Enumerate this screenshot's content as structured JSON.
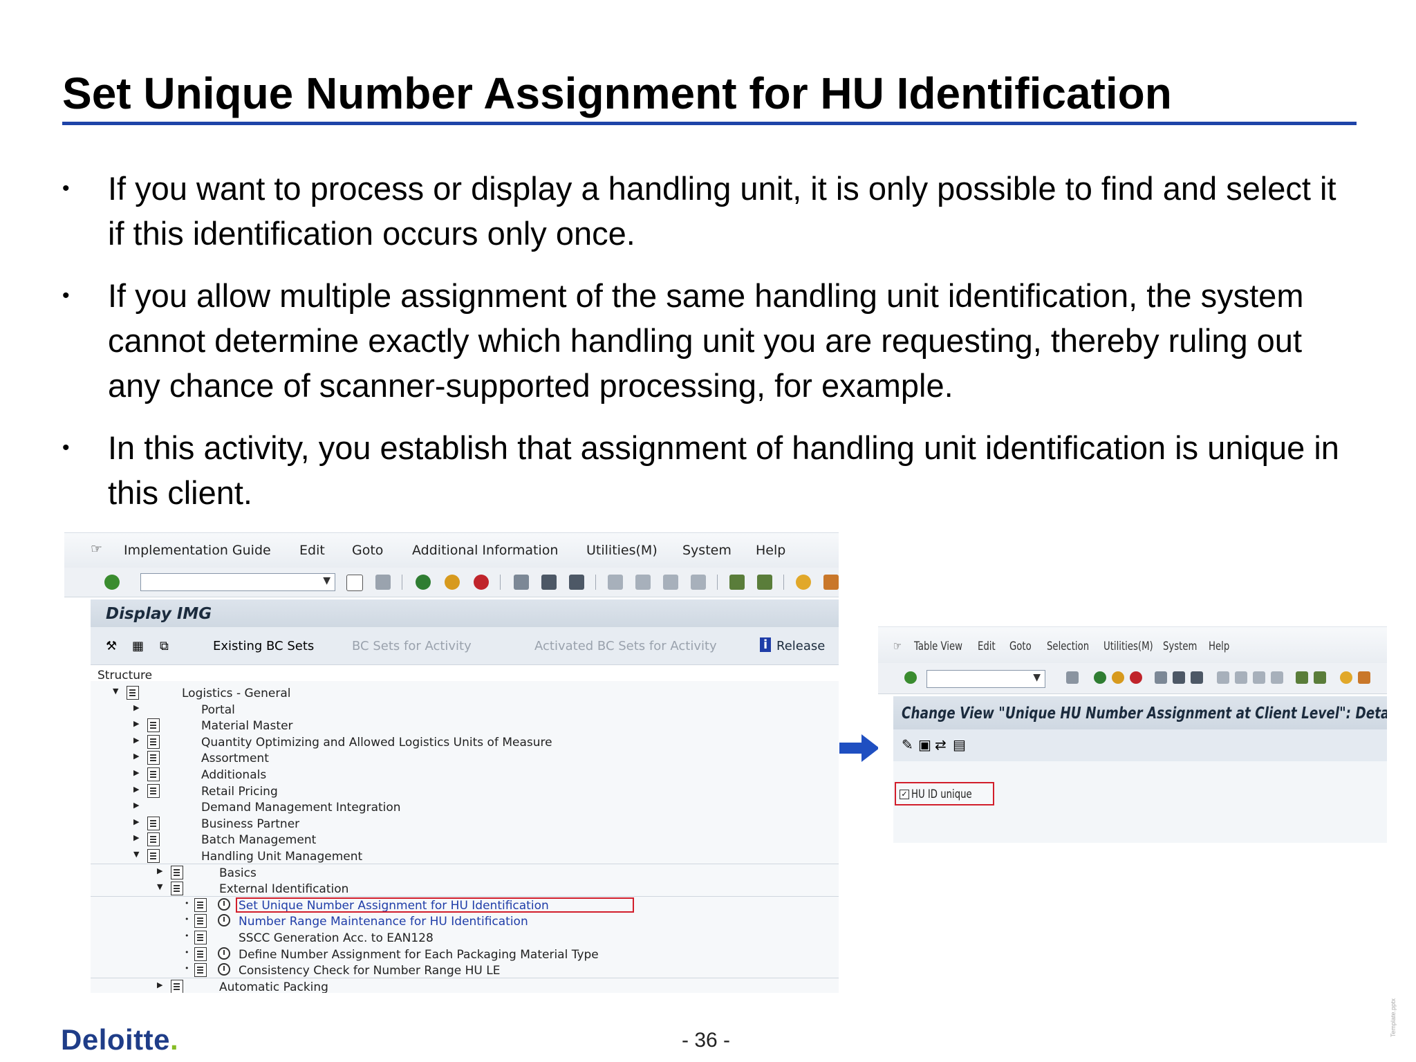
{
  "slide": {
    "title": "Set Unique Number Assignment for HU Identification",
    "bullets": [
      "If you want to process or display a handling unit, it is only possible to find and select it if this identification occurs only once.",
      "If you allow multiple assignment of the same handling unit identification, the system cannot determine exactly which handling unit you are requesting, thereby ruling out any chance of scanner-supported processing, for example.",
      "In this activity, you establish that assignment of handling unit identification is unique in this client."
    ],
    "bullet_marker": "•"
  },
  "sap_img": {
    "menu": [
      "Implementation Guide",
      "Edit",
      "Goto",
      "Additional Information",
      "Utilities(M)",
      "System",
      "Help"
    ],
    "screen_title": "Display IMG",
    "app_toolbar": {
      "existing_bc_sets": "Existing BC Sets",
      "bc_sets_for_activity": "BC Sets for Activity",
      "activated_bc_sets": "Activated BC Sets for Activity",
      "release_notes": "Release"
    },
    "structure_label": "Structure",
    "tree": [
      {
        "label": "Logistics - General",
        "level": 0,
        "expanded": true,
        "icons": "doc"
      },
      {
        "label": "Portal",
        "level": 1,
        "icons": "none"
      },
      {
        "label": "Material Master",
        "level": 1,
        "icons": "doc"
      },
      {
        "label": "Quantity Optimizing and Allowed Logistics Units of Measure",
        "level": 1,
        "icons": "doc"
      },
      {
        "label": "Assortment",
        "level": 1,
        "icons": "doc"
      },
      {
        "label": "Additionals",
        "level": 1,
        "icons": "doc"
      },
      {
        "label": "Retail Pricing",
        "level": 1,
        "icons": "doc"
      },
      {
        "label": "Demand Management Integration",
        "level": 1,
        "icons": "none"
      },
      {
        "label": "Business Partner",
        "level": 1,
        "icons": "doc"
      },
      {
        "label": "Batch Management",
        "level": 1,
        "icons": "doc"
      },
      {
        "label": "Handling Unit Management",
        "level": 1,
        "expanded": true,
        "icons": "doc"
      },
      {
        "label": "Basics",
        "level": 2,
        "icons": "doc"
      },
      {
        "label": "External Identification",
        "level": 2,
        "expanded": true,
        "icons": "doc"
      },
      {
        "label": "Set Unique Number Assignment for HU Identification",
        "level": 3,
        "icons": "doc-clock",
        "highlighted": true,
        "link": true
      },
      {
        "label": "Number Range Maintenance for HU Identification",
        "level": 3,
        "icons": "doc-clock",
        "link": true
      },
      {
        "label": "SSCC Generation Acc. to EAN128",
        "level": 3,
        "icons": "doc"
      },
      {
        "label": "Define Number Assignment for Each Packaging Material Type",
        "level": 3,
        "icons": "doc-clock"
      },
      {
        "label": "Consistency Check for Number Range HU LE",
        "level": 3,
        "icons": "doc-clock"
      },
      {
        "label": "Automatic Packing",
        "level": 2,
        "icons": "doc"
      }
    ]
  },
  "sap_detail": {
    "menu": [
      "Table View",
      "Edit",
      "Goto",
      "Selection",
      "Utilities(M)",
      "System",
      "Help"
    ],
    "screen_title": "Change View \"Unique HU Number Assignment at Client Level\": Details",
    "checkbox": {
      "label": "HU ID unique",
      "checked": true,
      "mark": "✓"
    }
  },
  "footer": {
    "logo_text": "Deloitte",
    "logo_dot": ".",
    "page_number": "- 36 -",
    "template_note": "Template.pptx"
  },
  "colors": {
    "title_rule": "#1e44a8",
    "logo": "#1f3d88",
    "logo_dot": "#86bc25",
    "highlight_box": "#d21e2b",
    "arrow": "#1f4fc1"
  }
}
